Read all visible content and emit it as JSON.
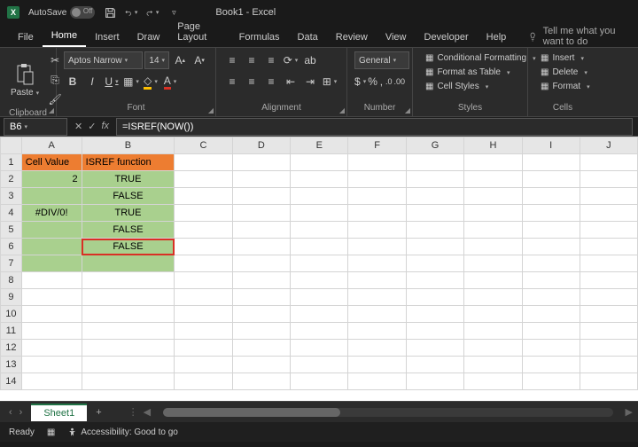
{
  "titlebar": {
    "autosave": "AutoSave",
    "toggle": "Off",
    "title": "Book1 - Excel"
  },
  "tabs": [
    "File",
    "Home",
    "Insert",
    "Draw",
    "Page Layout",
    "Formulas",
    "Data",
    "Review",
    "View",
    "Developer",
    "Help"
  ],
  "active_tab": 1,
  "tellme": "Tell me what you want to do",
  "ribbon": {
    "clipboard": {
      "label": "Clipboard",
      "paste": "Paste"
    },
    "font": {
      "label": "Font",
      "name": "Aptos Narrow",
      "size": "14",
      "bold": "B",
      "italic": "I",
      "underline": "U"
    },
    "alignment": {
      "label": "Alignment"
    },
    "number": {
      "label": "Number",
      "format": "General"
    },
    "styles": {
      "label": "Styles",
      "cond": "Conditional Formatting",
      "table": "Format as Table",
      "cell": "Cell Styles"
    },
    "cells": {
      "label": "Cells",
      "insert": "Insert",
      "delete": "Delete",
      "format": "Format"
    }
  },
  "fbar": {
    "namebox": "B6",
    "formula": "=ISREF(NOW())",
    "fx": "fx"
  },
  "columns": [
    "A",
    "B",
    "C",
    "D",
    "E",
    "F",
    "G",
    "H",
    "I",
    "J"
  ],
  "rows": [
    1,
    2,
    3,
    4,
    5,
    6,
    7,
    8,
    9,
    10,
    11,
    12,
    13,
    14
  ],
  "cells": {
    "A1": "Cell Value",
    "B1": "ISREF function",
    "A2": "2",
    "B2": "TRUE",
    "B3": "FALSE",
    "A4": "#DIV/0!",
    "B4": "TRUE",
    "B5": "FALSE",
    "B6": "FALSE"
  },
  "sheet": {
    "name": "Sheet1"
  },
  "status": {
    "ready": "Ready",
    "acc": "Accessibility: Good to go"
  }
}
